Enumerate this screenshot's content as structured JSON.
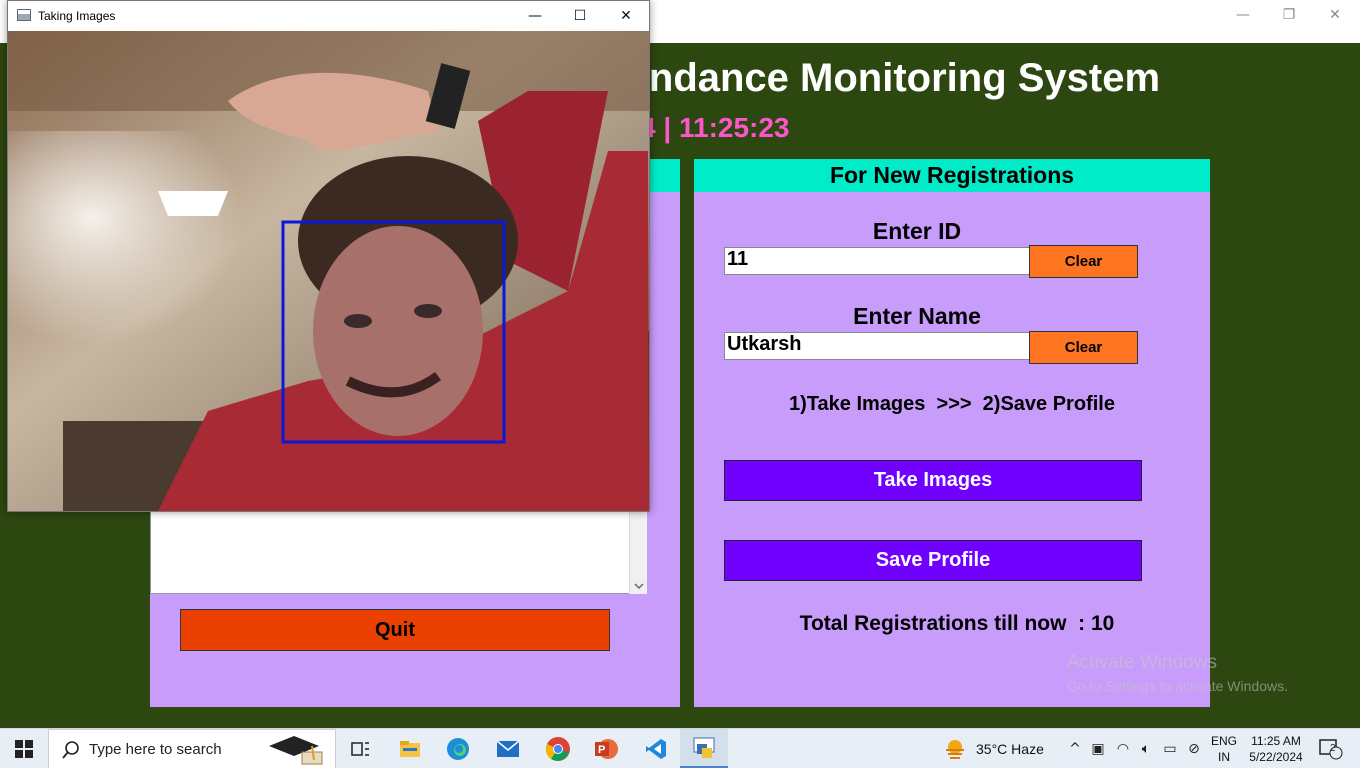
{
  "main_window": {
    "title": "Face Recognition Based Attendance Monitoring System",
    "title_visible": "ttendance Monitoring System",
    "datetime_visible": "4  |  11:25:23",
    "minimize_glyph": "—",
    "maximize_glyph": "❐",
    "close_glyph": "✕"
  },
  "left_panel": {
    "quit_label": "Quit"
  },
  "right_panel": {
    "header": "For New Registrations",
    "id_label": "Enter ID",
    "id_value": "11",
    "clear_id_label": "Clear",
    "name_label": "Enter Name",
    "name_value": "Utkarsh",
    "clear_name_label": "Clear",
    "steps": "1)Take Images  >>>  2)Save Profile",
    "take_images_label": "Take Images",
    "save_profile_label": "Save Profile",
    "total_registrations": "Total Registrations till now  : 10"
  },
  "camera_window": {
    "title": "Taking Images",
    "minimize_glyph": "—",
    "maximize_glyph": "☐",
    "close_glyph": "✕",
    "face_box_color": "#0a18d8"
  },
  "watermark": {
    "line1": "Activate Windows",
    "line2": "Go to Settings to activate Windows."
  },
  "taskbar": {
    "search_placeholder": "Type here to search",
    "apps": [
      "start-icon",
      "task-view-icon",
      "file-explorer-icon",
      "edge-icon",
      "mail-icon",
      "chrome-icon",
      "powerpoint-icon",
      "vscode-icon",
      "python-icon"
    ],
    "weather": "35°C  Haze",
    "lang_line1": "ENG",
    "lang_line2": "IN",
    "time": "11:25 AM",
    "date": "5/22/2024",
    "notification_count": "2"
  },
  "colors": {
    "background": "#2d4710",
    "panel": "#c79cfb",
    "header": "#00ecc8",
    "clear_button": "#ff7421",
    "action_button": "#7000ff",
    "quit_button": "#ea4000",
    "datetime": "#ff55cc"
  }
}
